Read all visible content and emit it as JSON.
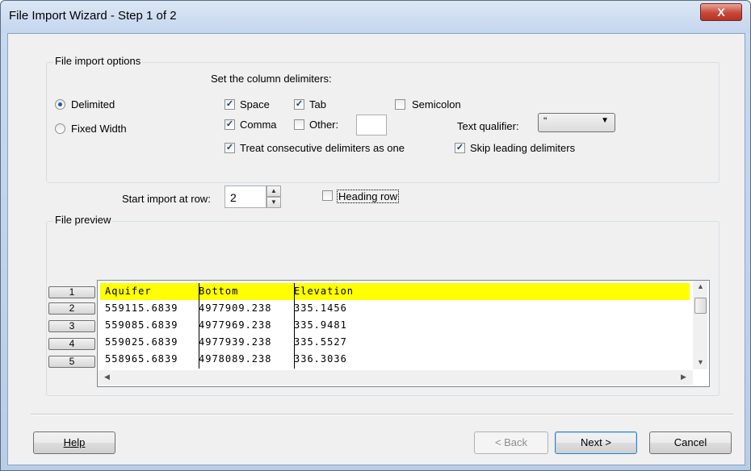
{
  "window": {
    "title": "File Import Wizard - Step 1 of 2",
    "close_label": "X"
  },
  "options_group": {
    "label": "File import options",
    "delimiters_heading": "Set the column delimiters:",
    "radio_delimited": "Delimited",
    "radio_fixed": "Fixed Width",
    "selected_mode": "Delimited",
    "cb_space": "Space",
    "cb_tab": "Tab",
    "cb_semicolon": "Semicolon",
    "cb_comma": "Comma",
    "cb_other": "Other:",
    "other_value": "",
    "cb_consecutive": "Treat consecutive delimiters as one",
    "cb_skip_leading": "Skip leading delimiters",
    "text_qualifier_label": "Text qualifier:",
    "text_qualifier_value": "\"",
    "checked": {
      "space": true,
      "tab": true,
      "semicolon": false,
      "comma": true,
      "other": false,
      "consecutive": true,
      "skip_leading": true
    }
  },
  "start_row": {
    "label": "Start import at row:",
    "value": "2"
  },
  "heading_row": {
    "label": "Heading row",
    "checked": false
  },
  "preview": {
    "label": "File preview",
    "row_numbers": [
      "1",
      "2",
      "3",
      "4",
      "5"
    ],
    "rows": [
      [
        "Aquifer",
        "Bottom",
        "Elevation"
      ],
      [
        "559115.6839",
        "4977909.238",
        "335.1456"
      ],
      [
        "559085.6839",
        "4977969.238",
        "335.9481"
      ],
      [
        "559025.6839",
        "4977939.238",
        "335.5527"
      ],
      [
        "558965.6839",
        "4978089.238",
        "336.3036"
      ]
    ],
    "highlight_color": "#ffff00"
  },
  "buttons": {
    "help": "Help",
    "back": "< Back",
    "next": "Next >",
    "cancel": "Cancel"
  }
}
